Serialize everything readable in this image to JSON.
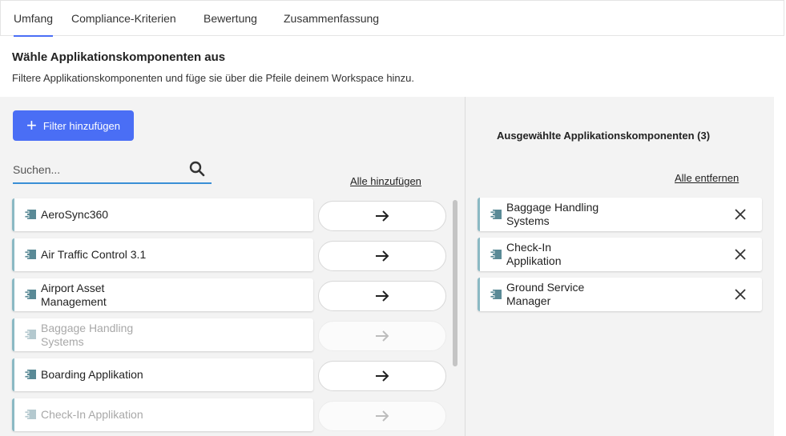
{
  "tabs": [
    {
      "label": "Umfang",
      "active": true
    },
    {
      "label": "Compliance-Kriterien",
      "active": false
    },
    {
      "label": "Bewertung",
      "active": false
    },
    {
      "label": "Zusammenfassung",
      "active": false
    }
  ],
  "header": {
    "title": "Wähle Applikationskomponenten aus",
    "subtitle": "Filtere Applikationskomponenten und füge sie über die Pfeile deinem Workspace hinzu."
  },
  "filter": {
    "button_label": "Filter hinzufügen",
    "icon": "plus-icon"
  },
  "search": {
    "placeholder": "Suchen...",
    "value": "",
    "icon": "search-icon"
  },
  "available": {
    "add_all_label": "Alle hinzufügen",
    "items": [
      {
        "line1": "AeroSync360",
        "line2": "",
        "disabled": false
      },
      {
        "line1": "Air Traffic Control 3.1",
        "line2": "",
        "disabled": false
      },
      {
        "line1": "Airport Asset",
        "line2": "Management",
        "disabled": false
      },
      {
        "line1": "Baggage Handling",
        "line2": "Systems",
        "disabled": true
      },
      {
        "line1": "Boarding Applikation",
        "line2": "",
        "disabled": false
      },
      {
        "line1": "Check-In Applikation",
        "line2": "",
        "disabled": true
      }
    ]
  },
  "selected": {
    "title": "Ausgewählte Applikationskomponenten (3)",
    "remove_all_label": "Alle entfernen",
    "items": [
      {
        "line1": "Baggage Handling",
        "line2": "Systems"
      },
      {
        "line1": "Check-In",
        "line2": "Applikation"
      },
      {
        "line1": "Ground Service",
        "line2": "Manager"
      }
    ]
  },
  "colors": {
    "accent": "#4a6ef5",
    "item_border": "#8bb9c4",
    "component_icon": "#5a8a96",
    "panel_bg": "#f3f3f3"
  }
}
